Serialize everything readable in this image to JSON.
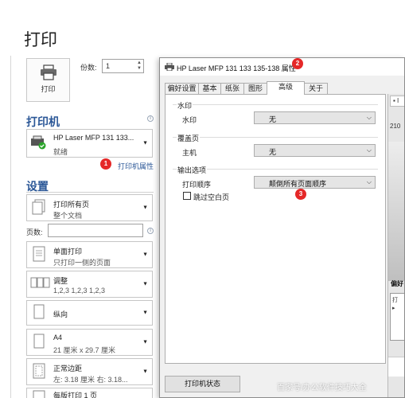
{
  "page_title": "打印",
  "print_button": {
    "label": "打印"
  },
  "copies": {
    "label": "份数:",
    "value": "1"
  },
  "printer_section": {
    "heading": "打印机",
    "name": "HP Laser MFP 131 133...",
    "status": "就绪",
    "properties_link": "打印机属性"
  },
  "settings_section": {
    "heading": "设置",
    "print_range": {
      "main": "打印所有页",
      "sub": "整个文档"
    },
    "pages_label": "页数:",
    "sides": {
      "main": "单面打印",
      "sub": "只打印一侧的页面"
    },
    "collate": {
      "main": "调整",
      "sub": "1,2,3    1,2,3    1,2,3"
    },
    "orientation": {
      "main": "纵向"
    },
    "paper_size": {
      "main": "A4",
      "sub": "21 厘米 x 29.7 厘米"
    },
    "margins": {
      "main": "正常边距",
      "sub": "左: 3.18 厘米    右: 3.18..."
    },
    "pages_per_sheet": {
      "main": "每版打印 1 页"
    }
  },
  "dialog": {
    "title": "HP Laser MFP 131 133 135-138 属性",
    "tabs": [
      "偏好设置",
      "基本",
      "纸张",
      "图形",
      "高级",
      "关于"
    ],
    "active_tab": "高级",
    "groups": {
      "watermark": {
        "label": "水印",
        "row_label": "水印",
        "value": "无"
      },
      "overlay": {
        "label": "覆盖页",
        "row_label": "主机",
        "value": "无"
      },
      "output": {
        "label": "输出选项",
        "row_label": "打印顺序",
        "value": "颠倒所有页面顺序",
        "skip_blank_label": "跳过空白页"
      }
    },
    "printer_status_button": "打印机状态"
  },
  "preview_fragment": {
    "num": "210",
    "label": "偏好",
    "list_a": "打",
    "list_b": "▸"
  },
  "badges": [
    "1",
    "2",
    "3"
  ],
  "watermark_text": "百家号/办公软件技巧大全",
  "colors": {
    "accent": "#2b5797",
    "badge": "#e52828"
  }
}
